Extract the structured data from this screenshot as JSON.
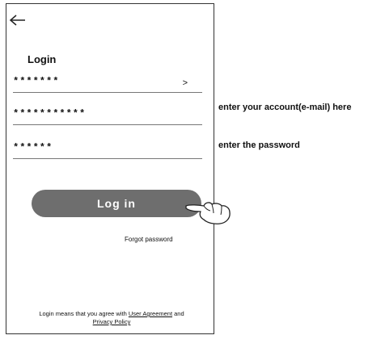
{
  "screen": {
    "title": "Login",
    "account_field": {
      "value": "*******",
      "arrow": ">"
    },
    "email_field": {
      "value": "***********"
    },
    "password_field": {
      "value": "******"
    },
    "login_button": "Log in",
    "forgot_password": "Forgot password",
    "agreement": {
      "prefix": "Login means that you agree with ",
      "user_agreement": "User Agreement",
      "and": " and",
      "privacy_policy": "Privacy Policy"
    }
  },
  "annotations": {
    "account": "enter your account(e-mail) here",
    "password": "enter the password"
  },
  "icons": {
    "back": "back-arrow-icon",
    "pointer": "pointing-hand-icon"
  }
}
